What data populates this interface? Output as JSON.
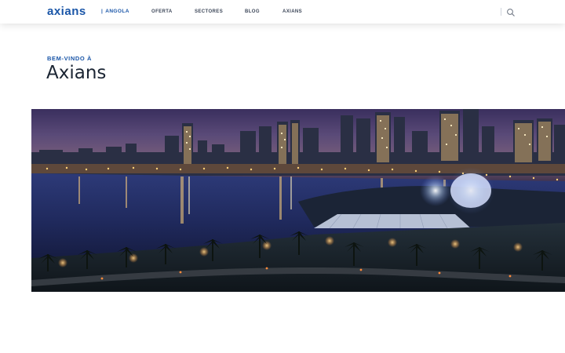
{
  "header": {
    "logo": "axians",
    "country": "ANGOLA",
    "nav": [
      "OFERTA",
      "SECTORES",
      "BLOG",
      "AXIANS"
    ]
  },
  "main": {
    "welcome": "BEM-VINDO À",
    "title": "Axians"
  },
  "icons": {
    "search": "search-icon"
  },
  "colors": {
    "brand": "#1a56a8",
    "text": "#1b2533",
    "nav": "#3c4658"
  }
}
